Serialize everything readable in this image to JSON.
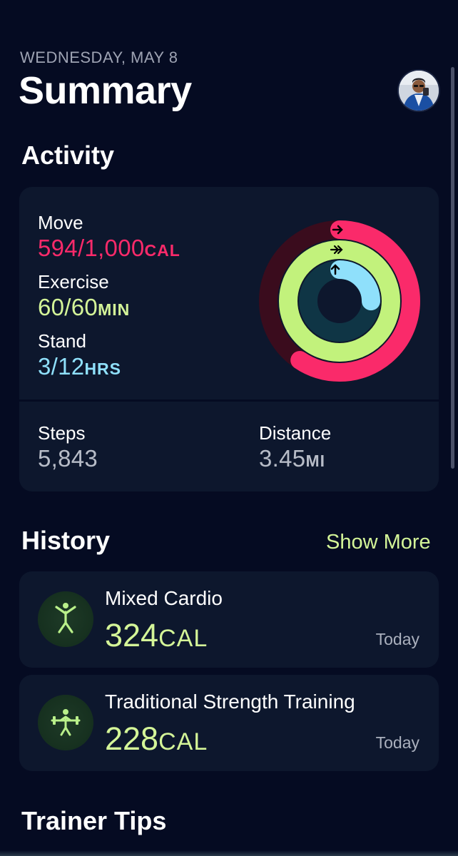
{
  "header": {
    "date": "WEDNESDAY, MAY 8",
    "title": "Summary"
  },
  "activity": {
    "section_title": "Activity",
    "move": {
      "label": "Move",
      "value": "594/1,000",
      "unit": "CAL",
      "progress": 0.594,
      "color": "#fa2a6a"
    },
    "exercise": {
      "label": "Exercise",
      "value": "60/60",
      "unit": "MIN",
      "progress": 1.0,
      "color": "#d4f598"
    },
    "stand": {
      "label": "Stand",
      "value": "3/12",
      "unit": "HRS",
      "progress": 0.25,
      "color": "#8fe0fb"
    },
    "steps": {
      "label": "Steps",
      "value": "5,843"
    },
    "distance": {
      "label": "Distance",
      "value": "3.45",
      "unit": "MI"
    }
  },
  "history": {
    "section_title": "History",
    "show_more": "Show More",
    "workouts": [
      {
        "name": "Mixed Cardio",
        "calories": "324",
        "unit": "CAL",
        "date": "Today",
        "icon": "mixed-cardio-icon"
      },
      {
        "name": "Traditional Strength Training",
        "calories": "228",
        "unit": "CAL",
        "date": "Today",
        "icon": "strength-training-icon"
      }
    ]
  },
  "trainer_tips": {
    "section_title": "Trainer Tips"
  }
}
